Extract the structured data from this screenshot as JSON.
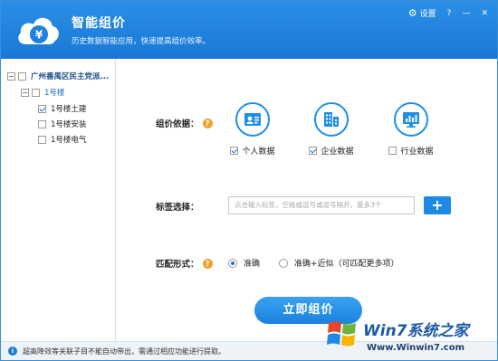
{
  "header": {
    "title": "智能组价",
    "subtitle": "历史数据智能应用，快速提高组价效率。",
    "settings_label": "设置",
    "help_label": "?",
    "minimize_label": "—",
    "close_label": "✕",
    "logo_glyph": "¥"
  },
  "sidebar": {
    "root_label": "广州番禺区民主党派...",
    "building_label": "1号楼",
    "items": [
      {
        "label": "1号楼土建",
        "checked": true
      },
      {
        "label": "1号楼安装",
        "checked": false
      },
      {
        "label": "1号楼电气",
        "checked": false
      }
    ]
  },
  "main": {
    "basis_label": "组价依据：",
    "sources": [
      {
        "label": "个人数据",
        "checked": true,
        "icon": "person-data-icon"
      },
      {
        "label": "企业数据",
        "checked": true,
        "icon": "enterprise-data-icon"
      },
      {
        "label": "行业数据",
        "checked": false,
        "icon": "industry-data-icon"
      }
    ],
    "tag_label": "标签选择：",
    "tag_placeholder": "点击输入标签，空格或逗号或逗号隔开，最多3个",
    "add_label": "+",
    "match_label": "匹配形式：",
    "match_options": [
      {
        "label": "准确",
        "selected": true
      },
      {
        "label": "准确+近似（可匹配更多项）",
        "selected": false
      }
    ],
    "submit_label": "立即组价"
  },
  "footer": {
    "info_glyph": "i",
    "message": "超高降效等关联子目不能自动带出，需通过相应功能进行提取。"
  },
  "watermark": {
    "brand": "Win7系统之家",
    "url": "Www.Winwin7.com"
  },
  "colors": {
    "primary": "#1e8ae6",
    "help_orange": "#f0a32c"
  }
}
